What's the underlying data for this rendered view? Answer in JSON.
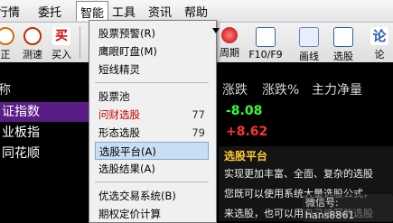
{
  "menubar": {
    "items": [
      {
        "label": "行情"
      },
      {
        "label": "委托"
      },
      {
        "label": "智能"
      },
      {
        "label": "工具"
      },
      {
        "label": "资讯"
      },
      {
        "label": "帮助"
      }
    ]
  },
  "toolbar": {
    "items": [
      {
        "label": "正",
        "icon": "record-icon"
      },
      {
        "label": "测速",
        "icon": "clock-icon"
      },
      {
        "label": "买入",
        "icon": "buy-icon"
      },
      {
        "label": "周期",
        "icon": "circle-icon"
      },
      {
        "label": "F10/F9",
        "icon": "document-icon"
      },
      {
        "label": "画线",
        "icon": "draw-line-icon"
      },
      {
        "label": "选股",
        "icon": "screener-icon"
      },
      {
        "label": "论",
        "icon": "forum-icon"
      }
    ],
    "buy_text": "买",
    "forum_text": "论"
  },
  "table": {
    "headers": [
      "称",
      "涨跌",
      "涨跌%",
      "主力净量"
    ],
    "rows": [
      {
        "name": "证指数",
        "change": "-8.08",
        "selected": true
      },
      {
        "name": "业板指",
        "change": "+8.62",
        "selected": false
      },
      {
        "name": "同花顺",
        "change": "",
        "selected": false
      }
    ],
    "colors": {
      "down": "#33ff33",
      "up": "#ff3333",
      "selected_row": "#5a1d86"
    }
  },
  "menu": {
    "items": [
      {
        "label": "股票预警(R)",
        "key": "",
        "style": "normal"
      },
      {
        "label": "鹰眼盯盘(M)",
        "key": "",
        "style": "normal"
      },
      {
        "label": "短线精灵",
        "key": "",
        "style": "normal"
      },
      {
        "label": "股票池",
        "key": "",
        "style": "normal"
      },
      {
        "label": "问财选股",
        "key": "77",
        "style": "red"
      },
      {
        "label": "形态选股",
        "key": "79",
        "style": "normal"
      },
      {
        "label": "选股平台(A)",
        "key": "",
        "style": "highlight"
      },
      {
        "label": "选股结果(A)",
        "key": "",
        "style": "normal"
      },
      {
        "label": "优选交易系统(B)",
        "key": "",
        "style": "normal"
      },
      {
        "label": "期权定价计算",
        "key": "",
        "style": "normal"
      }
    ]
  },
  "tooltip": {
    "title": "选股平台",
    "lines": [
      "实现更加丰富、全面、复杂的选股",
      "您既可以使用系统大量选股公式，",
      "来选股，也可以用自己编写的选股"
    ]
  },
  "watermark": {
    "text": "微信号: hans8861"
  }
}
